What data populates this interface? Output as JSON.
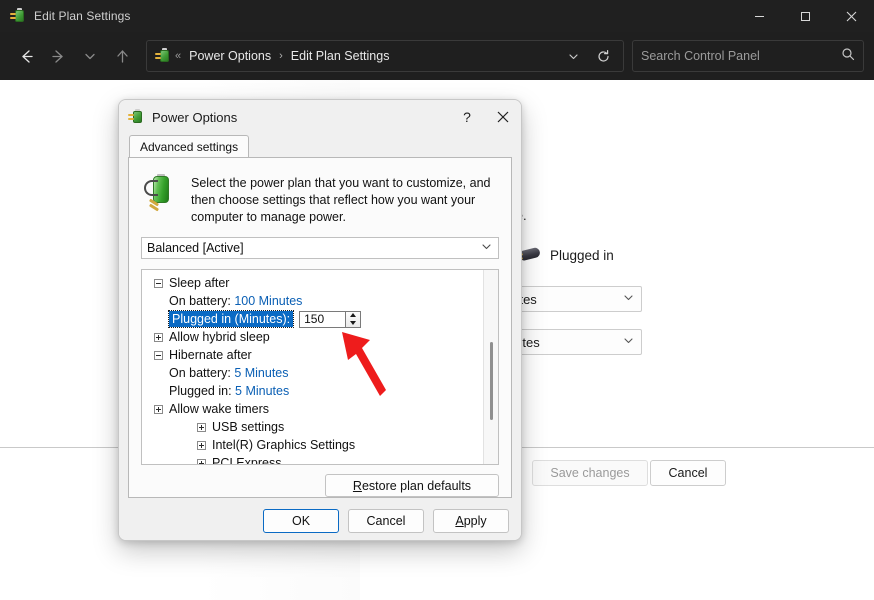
{
  "window": {
    "title": "Edit Plan Settings",
    "icon": "power-plug-icon",
    "controls": {
      "minimize": "—",
      "maximize": "☐",
      "close": "✕"
    }
  },
  "toolbar": {
    "back_icon": "arrow-left-icon",
    "forward_icon": "arrow-right-icon",
    "recent_icon": "chevron-down-icon",
    "up_icon": "arrow-up-icon",
    "address": {
      "icon": "power-plug-icon",
      "overflow": "«",
      "crumbs": [
        "Power Options",
        "Edit Plan Settings"
      ],
      "separator": "›",
      "dropdown_icon": "chevron-down-icon",
      "refresh_icon": "refresh-icon"
    },
    "search": {
      "placeholder": "Search Control Panel",
      "icon": "search-icon"
    }
  },
  "background_page": {
    "trailing_text": "use.",
    "plugged_in_label": "Plugged in",
    "plugged_in_icon": "ac-plug-icon",
    "combo_1_value": "nutes",
    "combo_2_value": "inutes",
    "save_changes_label": "Save changes",
    "save_changes_enabled": false,
    "cancel_label": "Cancel"
  },
  "dialog": {
    "title": "Power Options",
    "icon": "power-plug-icon",
    "help_label": "?",
    "close_label": "✕",
    "tab": "Advanced settings",
    "intro_icon": "battery-plug-icon",
    "intro_text": "Select the power plan that you want to customize, and then choose settings that reflect how you want your computer to manage power.",
    "plan_select": {
      "value": "Balanced [Active]",
      "chevron": "⌄"
    },
    "tree": [
      {
        "level": 0,
        "toggle": "minus",
        "label": "Sleep after",
        "type": "group"
      },
      {
        "level": 1,
        "toggle": "none",
        "label": "On battery:",
        "value": "100 Minutes",
        "type": "setting-link"
      },
      {
        "level": 1,
        "toggle": "none",
        "label": "Plugged in (Minutes):",
        "value": "150",
        "type": "setting-spinner",
        "selected": true
      },
      {
        "level": 0,
        "toggle": "plus",
        "label": "Allow hybrid sleep",
        "type": "group"
      },
      {
        "level": 0,
        "toggle": "minus",
        "label": "Hibernate after",
        "type": "group"
      },
      {
        "level": 1,
        "toggle": "none",
        "label": "On battery:",
        "value": "5 Minutes",
        "type": "setting-link"
      },
      {
        "level": 1,
        "toggle": "none",
        "label": "Plugged in:",
        "value": "5 Minutes",
        "type": "setting-link"
      },
      {
        "level": 0,
        "toggle": "plus",
        "label": "Allow wake timers",
        "type": "group"
      },
      {
        "level": 2,
        "toggle": "plus",
        "label": "USB settings",
        "type": "group"
      },
      {
        "level": 2,
        "toggle": "plus",
        "label": "Intel(R) Graphics Settings",
        "type": "group"
      },
      {
        "level": 2,
        "toggle": "plus",
        "label": "PCI Express",
        "type": "group"
      }
    ],
    "restore_button": {
      "prefix": "R",
      "rest": "estore plan defaults"
    },
    "footer": {
      "ok": "OK",
      "cancel": "Cancel",
      "apply_prefix": "A",
      "apply_rest": "pply"
    }
  },
  "annotation": {
    "arrow": "red-arrow-pointer",
    "color": "#ee1c1c"
  }
}
